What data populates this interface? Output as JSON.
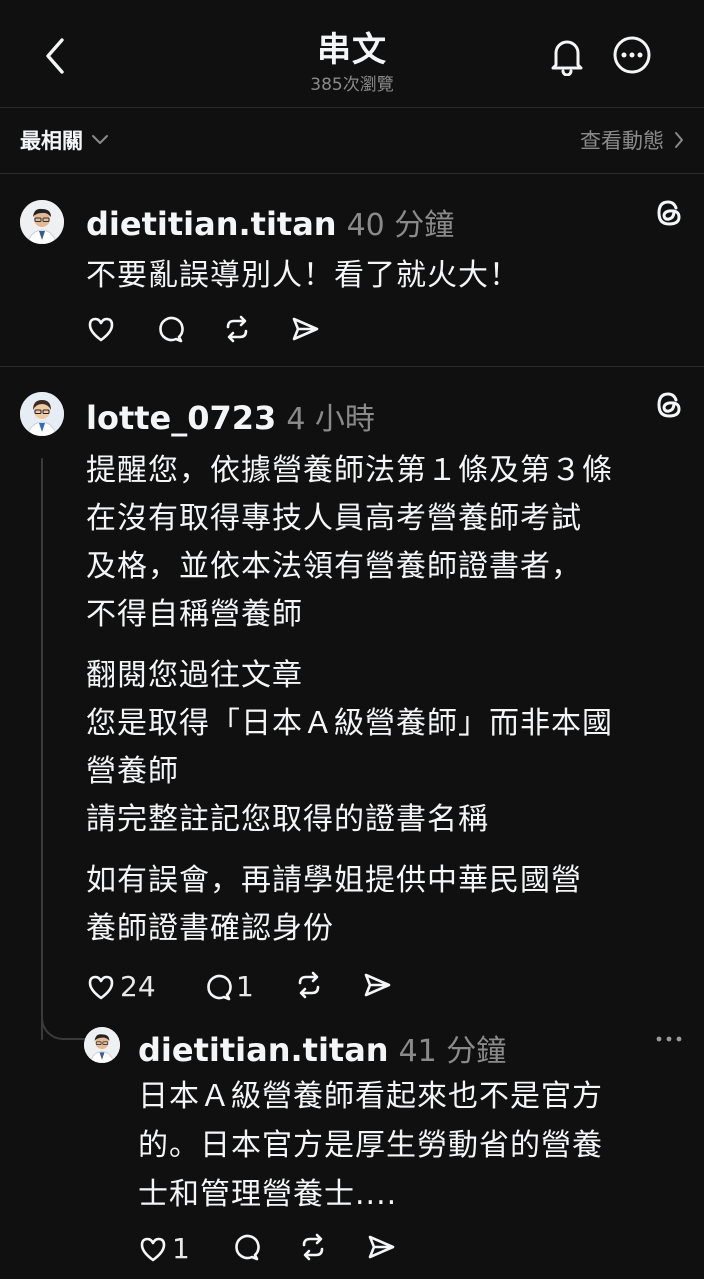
{
  "header": {
    "title": "串文",
    "views": "385次瀏覽"
  },
  "subbar": {
    "sort_label": "最相關",
    "activity_label": "查看動態"
  },
  "post1": {
    "username": "dietitian.titan",
    "time": "40 分鐘",
    "text": "不要亂誤導別人！看了就火大！"
  },
  "post2": {
    "username": "lotte_0723",
    "time": "4 小時",
    "paragraph1": [
      "提醒您，依據營養師法第１條及第３條",
      "在沒有取得專技人員高考營養師考試",
      "及格，並依本法領有營養師證書者，",
      "不得自稱營養師"
    ],
    "paragraph2": [
      "翻閱您過往文章",
      "您是取得「日本Ａ級營養師」而非本國",
      "營養師",
      "請完整註記您取得的證書名稱"
    ],
    "paragraph3": [
      "如有誤會，再請學姐提供中華民國營",
      "養師證書確認身份"
    ],
    "likes": "24",
    "replies": "1"
  },
  "reply": {
    "username": "dietitian.titan",
    "time": "41 分鐘",
    "lines": [
      "日本Ａ級營養師看起來也不是官方",
      "的。日本官方是厚生勞動省的營養",
      "士和管理營養士...."
    ],
    "likes": "1"
  },
  "icons": {
    "back": "chevron-left-icon",
    "bell": "bell-icon",
    "more": "more-circle-icon",
    "threads": "threads-logo-icon",
    "like": "heart-icon",
    "comment": "comment-icon",
    "repost": "repost-icon",
    "share": "send-icon"
  }
}
